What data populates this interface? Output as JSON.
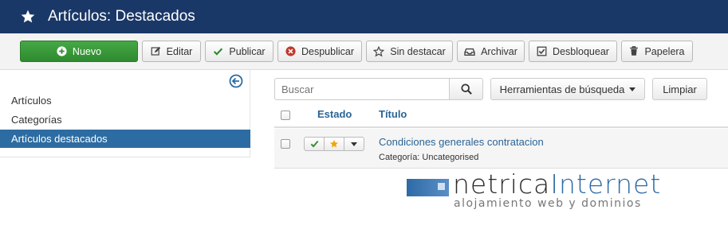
{
  "header": {
    "title": "Artículos: Destacados",
    "icon": "star-icon"
  },
  "toolbar": {
    "new_label": "Nuevo",
    "edit_label": "Editar",
    "publish_label": "Publicar",
    "unpublish_label": "Despublicar",
    "unfeature_label": "Sin destacar",
    "archive_label": "Archivar",
    "checkin_label": "Desbloquear",
    "trash_label": "Papelera"
  },
  "sidebar": {
    "items": [
      {
        "label": "Artículos",
        "active": false
      },
      {
        "label": "Categorías",
        "active": false
      },
      {
        "label": "Artículos destacados",
        "active": true
      }
    ]
  },
  "search": {
    "placeholder": "Buscar",
    "tools_label": "Herramientas de búsqueda",
    "clear_label": "Limpiar"
  },
  "table": {
    "columns": {
      "status": "Estado",
      "title": "Título"
    },
    "rows": [
      {
        "title": "Condiciones generales contratacion",
        "category": "Categoría: Uncategorised",
        "published": true,
        "featured": true
      }
    ]
  },
  "logo": {
    "name_part1": "netrica",
    "name_part2": "Internet",
    "tagline": "alojamiento web y dominios"
  },
  "colors": {
    "header_bg": "#1a3867",
    "active_item": "#2d6ca2",
    "link": "#2a6496",
    "success": "#2f8a2f",
    "danger": "#c0392b",
    "featured_star": "#f0a500"
  }
}
